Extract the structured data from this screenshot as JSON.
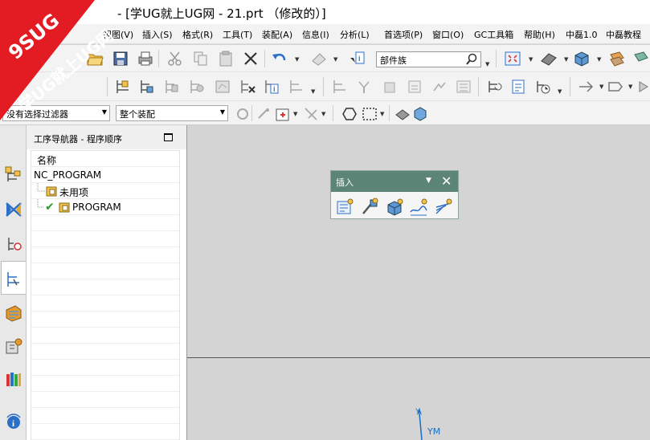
{
  "window": {
    "title": "- [学UG就上UG网 - 21.prt （修改的）]"
  },
  "watermark": {
    "line1": "9SUG",
    "line2": "学UG就上UG网"
  },
  "menu": [
    {
      "label": "视图(V)"
    },
    {
      "label": "插入(S)"
    },
    {
      "label": "格式(R)"
    },
    {
      "label": "工具(T)"
    },
    {
      "label": "装配(A)"
    },
    {
      "label": "信息(I)"
    },
    {
      "label": "分析(L)"
    },
    {
      "label": "首选项(P)"
    },
    {
      "label": "窗口(O)"
    },
    {
      "label": "GC工具箱"
    },
    {
      "label": "帮助(H)"
    },
    {
      "label": "中磊1.0"
    },
    {
      "label": "中磊教程"
    }
  ],
  "toolbar": {
    "search_placeholder": "部件族",
    "filter_value": "没有选择过滤器",
    "assembly_value": "整个装配"
  },
  "navigator": {
    "title": "工序导航器 - 程序顺序",
    "column_header": "名称",
    "root": "NC_PROGRAM",
    "children": [
      {
        "label": "未用项"
      },
      {
        "label": "PROGRAM"
      }
    ]
  },
  "insert_toolbar": {
    "title": "插入"
  },
  "axis": {
    "y_label": "YM"
  },
  "colors": {
    "insert_header": "#5d8577",
    "watermark": "#e31b23",
    "axis": "#1a6cc6"
  }
}
